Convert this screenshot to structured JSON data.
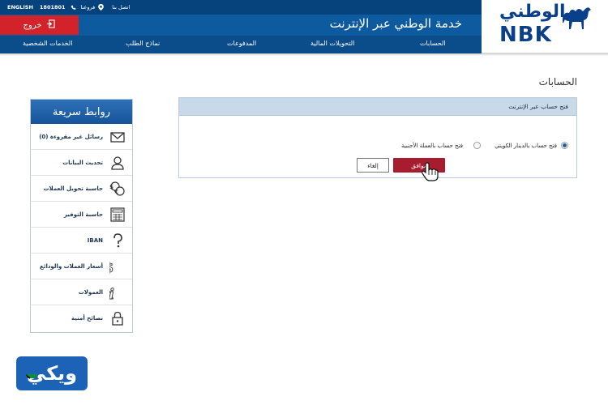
{
  "topbar": {
    "language": "ENGLISH",
    "phone": "1801801",
    "branches": "فروعنا",
    "contact": "اتصل بنا"
  },
  "header": {
    "logout_label": "خروج",
    "site_title": "خدمة الوطني عبر الإنترنت",
    "logo_ar": "الوطني",
    "logo_en": "NBK"
  },
  "nav": {
    "accounts": "الحسابات",
    "transfers": "التحويلات المالية",
    "payments": "المدفوعات",
    "request_forms": "نماذج الطلب",
    "personal_services": "الخدمات الشخصية"
  },
  "page": {
    "heading": "الحسابات"
  },
  "form": {
    "title": "فتح حساب عبر الإنترنت",
    "option_kwd": "فتح حساب بالدينار الكويتي",
    "option_foreign": "فتح حساب بالعملة الأجنبية",
    "ok_label": "موافق",
    "cancel_label": "إلغاء",
    "selected_option": "option_kwd"
  },
  "quick_links": {
    "title": "روابط سريعة",
    "items": [
      {
        "label": "رسائل غير مقروءة (0)",
        "icon": "envelope-icon"
      },
      {
        "label": "تحديث البيانات",
        "icon": "user-icon"
      },
      {
        "label": "حاسبة تحويل العملات",
        "icon": "currency-exchange-icon"
      },
      {
        "label": "حاسبة التوفير",
        "icon": "calculator-icon"
      },
      {
        "label": "IBAN",
        "icon": "question-icon"
      },
      {
        "label": "أسعار العملات والودائع",
        "icon": "dollar-icon"
      },
      {
        "label": "العمولات",
        "icon": "info-icon"
      },
      {
        "label": "نصائح أمنية",
        "icon": "lock-icon"
      }
    ]
  },
  "badge": {
    "text": "ويكي"
  },
  "colors": {
    "header_blue": "#0d5a9e",
    "logout_red": "#d2232a",
    "ok_button": "#a71c2f",
    "panel_header": "#c8d9ea",
    "quick_header": "#1c5fa6"
  }
}
